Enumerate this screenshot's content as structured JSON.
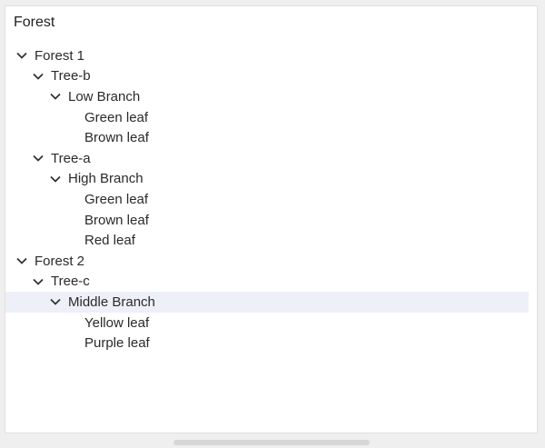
{
  "panel": {
    "title": "Forest"
  },
  "tree": {
    "forest1": {
      "label": "Forest 1",
      "treeB": {
        "label": "Tree-b",
        "lowBranch": {
          "label": "Low Branch",
          "leaves": [
            "Green leaf",
            "Brown leaf"
          ]
        }
      },
      "treeA": {
        "label": "Tree-a",
        "highBranch": {
          "label": "High Branch",
          "leaves": [
            "Green leaf",
            "Brown leaf",
            "Red leaf"
          ]
        }
      }
    },
    "forest2": {
      "label": "Forest 2",
      "treeC": {
        "label": "Tree-c",
        "middleBranch": {
          "label": "Middle Branch",
          "leaves": [
            "Yellow leaf",
            "Purple leaf"
          ]
        }
      }
    }
  },
  "colors": {
    "selected_row": "#eef0f8",
    "text": "#2a2a2a"
  }
}
